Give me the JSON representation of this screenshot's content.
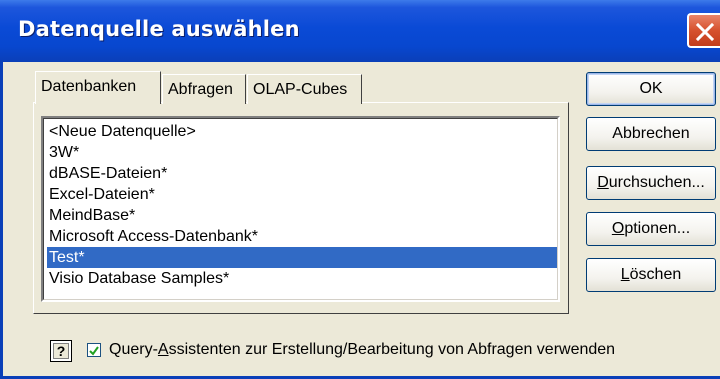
{
  "window": {
    "title": "Datenquelle auswählen"
  },
  "tabs": [
    {
      "label": "Datenbanken",
      "selected": true
    },
    {
      "label": "Abfragen",
      "selected": false
    },
    {
      "label": "OLAP-Cubes",
      "selected": false
    }
  ],
  "list": {
    "items": [
      "<Neue Datenquelle>",
      "3W*",
      "dBASE-Dateien*",
      "Excel-Dateien*",
      "MeindBase*",
      "Microsoft Access-Datenbank*",
      "Test*",
      "Visio Database Samples*"
    ],
    "selected_index": 6
  },
  "buttons": {
    "ok": "OK",
    "cancel": "Abbrechen",
    "browse_pre": "",
    "browse_key": "D",
    "browse_post": "urchsuchen...",
    "options_pre": "",
    "options_key": "O",
    "options_post": "ptionen...",
    "delete_pre": "",
    "delete_key": "L",
    "delete_post": "öschen"
  },
  "checkbox": {
    "checked": true,
    "label_pre": "Query-",
    "label_key": "A",
    "label_post": "ssistenten zur Erstellung/Bearbeitung von Abfragen verwenden"
  },
  "colors": {
    "selection": "#316ac5",
    "titlebar": "#0a4ad6",
    "close": "#d6512d"
  },
  "icons": {
    "close": "close-icon",
    "help": "help-icon",
    "check": "check-icon"
  }
}
